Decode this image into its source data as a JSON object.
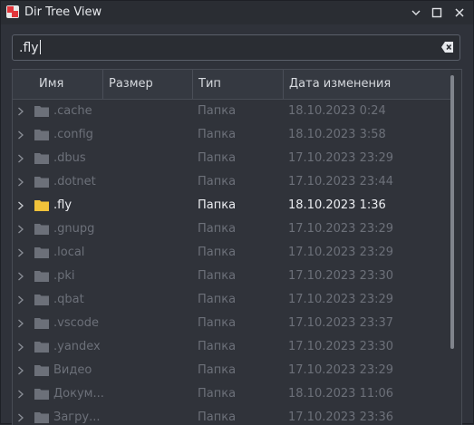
{
  "window": {
    "title": "Dir Tree View",
    "controls": {
      "minimize": "minimize-icon",
      "maximize": "maximize-icon",
      "close": "close-icon"
    }
  },
  "search": {
    "value": ".fly",
    "clear_icon": "clear-icon"
  },
  "columns": [
    "Имя",
    "Размер",
    "Тип",
    "Дата изменения"
  ],
  "rows": [
    {
      "name": ".cache",
      "size": "",
      "type": "Папка",
      "date": "18.10.2023 0:24",
      "active": false
    },
    {
      "name": ".config",
      "size": "",
      "type": "Папка",
      "date": "18.10.2023 3:58",
      "active": false
    },
    {
      "name": ".dbus",
      "size": "",
      "type": "Папка",
      "date": "17.10.2023 23:29",
      "active": false
    },
    {
      "name": ".dotnet",
      "size": "",
      "type": "Папка",
      "date": "17.10.2023 23:44",
      "active": false
    },
    {
      "name": ".fly",
      "size": "",
      "type": "Папка",
      "date": "18.10.2023 1:36",
      "active": true
    },
    {
      "name": ".gnupg",
      "size": "",
      "type": "Папка",
      "date": "17.10.2023 23:29",
      "active": false
    },
    {
      "name": ".local",
      "size": "",
      "type": "Папка",
      "date": "17.10.2023 23:29",
      "active": false
    },
    {
      "name": ".pki",
      "size": "",
      "type": "Папка",
      "date": "17.10.2023 23:30",
      "active": false
    },
    {
      "name": ".qbat",
      "size": "",
      "type": "Папка",
      "date": "17.10.2023 23:29",
      "active": false
    },
    {
      "name": ".vscode",
      "size": "",
      "type": "Папка",
      "date": "17.10.2023 23:37",
      "active": false
    },
    {
      "name": ".yandex",
      "size": "",
      "type": "Папка",
      "date": "17.10.2023 23:30",
      "active": false
    },
    {
      "name": "Видео",
      "size": "",
      "type": "Папка",
      "date": "17.10.2023 23:29",
      "active": false
    },
    {
      "name": "Докум...",
      "size": "",
      "type": "Папка",
      "date": "18.10.2023 11:06",
      "active": false
    },
    {
      "name": "Загру...",
      "size": "",
      "type": "Папка",
      "date": "17.10.2023 23:36",
      "active": false
    }
  ],
  "colors": {
    "active_folder": "#f0c23b",
    "dim_folder": "#6c7079",
    "active_text": "#eceef2",
    "dim_text": "#6c7079"
  }
}
